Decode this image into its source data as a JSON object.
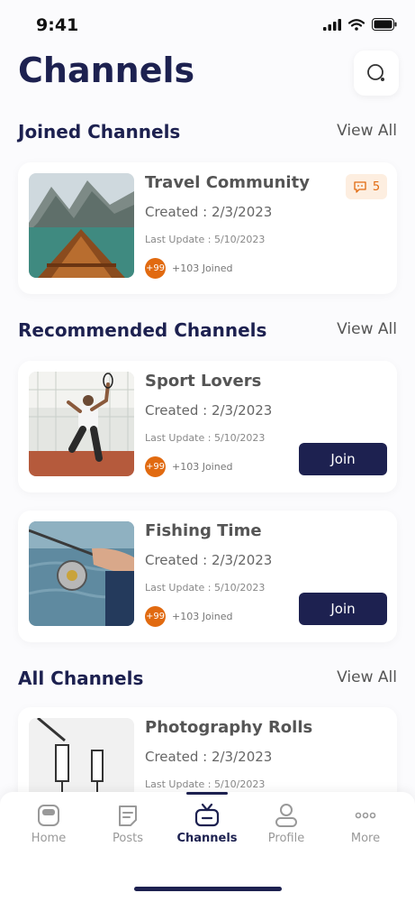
{
  "status": {
    "time": "9:41"
  },
  "header": {
    "title": "Channels"
  },
  "sections": {
    "joined": {
      "title": "Joined Channels",
      "view_all": "View All"
    },
    "recommended": {
      "title": "Recommended Channels",
      "view_all": "View All"
    },
    "all": {
      "title": "All Channels",
      "view_all": "View All"
    }
  },
  "cards": {
    "travel": {
      "title": "Travel Community",
      "created": "Created : 2/3/2023",
      "update": "Last Update : 5/10/2023",
      "badge": "+99",
      "joined": "+103 Joined",
      "messages": "5"
    },
    "sport": {
      "title": "Sport Lovers",
      "created": "Created : 2/3/2023",
      "update": "Last Update : 5/10/2023",
      "badge": "+99",
      "joined": "+103 Joined",
      "join": "Join"
    },
    "fishing": {
      "title": "Fishing Time",
      "created": "Created : 2/3/2023",
      "update": "Last Update : 5/10/2023",
      "badge": "+99",
      "joined": "+103 Joined",
      "join": "Join"
    },
    "photo": {
      "title": "Photography Rolls",
      "created": "Created : 2/3/2023",
      "update": "Last Update : 5/10/2023"
    }
  },
  "tabs": [
    {
      "label": "Home",
      "icon": "home-icon"
    },
    {
      "label": "Posts",
      "icon": "posts-icon"
    },
    {
      "label": "Channels",
      "icon": "channels-icon",
      "active": true
    },
    {
      "label": "Profile",
      "icon": "profile-icon"
    },
    {
      "label": "More",
      "icon": "more-icon"
    }
  ],
  "colors": {
    "primary": "#1d2150",
    "accent": "#e16a10"
  }
}
